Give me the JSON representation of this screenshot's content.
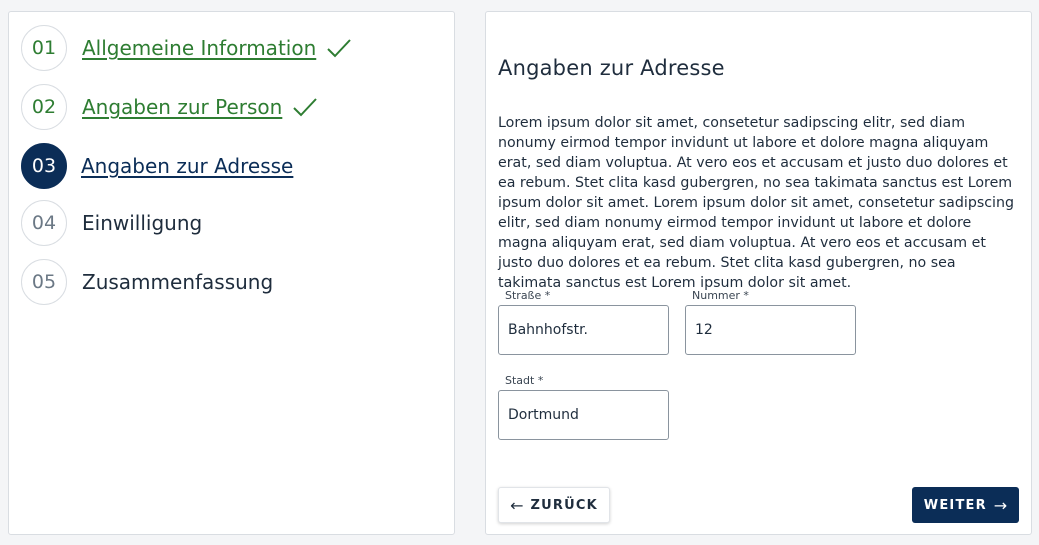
{
  "stepper": {
    "steps": [
      {
        "number": "01",
        "label": "Allgemeine Information",
        "state": "done"
      },
      {
        "number": "02",
        "label": "Angaben zur Person",
        "state": "done"
      },
      {
        "number": "03",
        "label": "Angaben zur Adresse",
        "state": "active"
      },
      {
        "number": "04",
        "label": "Einwilligung",
        "state": "pending"
      },
      {
        "number": "05",
        "label": "Zusammenfassung",
        "state": "pending"
      }
    ]
  },
  "form": {
    "title": "Angaben zur Adresse",
    "description": "Lorem ipsum dolor sit amet, consetetur sadipscing elitr, sed diam nonumy eirmod tempor invidunt ut labore et dolore magna aliquyam erat, sed diam voluptua. At vero eos et accusam et justo duo dolores et ea rebum. Stet clita kasd gubergren, no sea takimata sanctus est Lorem ipsum dolor sit amet. Lorem ipsum dolor sit amet, consetetur sadipscing elitr, sed diam nonumy eirmod tempor invidunt ut labore et dolore magna aliquyam erat, sed diam voluptua. At vero eos et accusam et justo duo dolores et ea rebum. Stet clita kasd gubergren, no sea takimata sanctus est Lorem ipsum dolor sit amet.",
    "fields": {
      "street": {
        "label": "Straße *",
        "value": "Bahnhofstr."
      },
      "number": {
        "label": "Nummer *",
        "value": "12"
      },
      "city": {
        "label": "Stadt *",
        "value": "Dortmund"
      }
    }
  },
  "actions": {
    "back_label": "ZURÜCK",
    "next_label": "WEITER",
    "back_icon": "arrow-left-icon",
    "next_icon": "arrow-right-icon"
  },
  "colors": {
    "primary": "#0b2d57",
    "success": "#2e7d32",
    "border": "#d9dde2"
  }
}
